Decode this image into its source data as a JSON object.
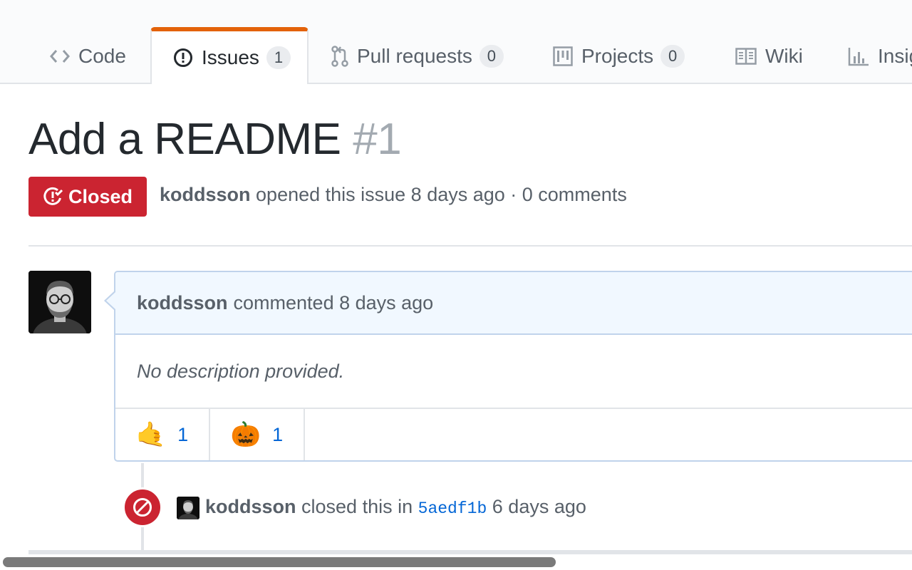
{
  "tabs": [
    {
      "label": "Code",
      "icon": "code-icon"
    },
    {
      "label": "Issues",
      "count": "1",
      "icon": "issue-opened-icon",
      "selected": true
    },
    {
      "label": "Pull requests",
      "count": "0",
      "icon": "git-pull-request-icon"
    },
    {
      "label": "Projects",
      "count": "0",
      "icon": "project-icon"
    },
    {
      "label": "Wiki",
      "icon": "book-icon"
    },
    {
      "label": "Insig",
      "icon": "graph-icon"
    }
  ],
  "issue": {
    "title": "Add a README",
    "number": "#1",
    "state": "Closed",
    "author": "koddsson",
    "meta_text": "opened this issue 8 days ago · 0 comments"
  },
  "comment": {
    "author": "koddsson",
    "header_text": "commented 8 days ago",
    "body": "No description provided.",
    "reactions": [
      {
        "emoji": "🤙",
        "icon": "call-me-hand-emoji",
        "count": "1"
      },
      {
        "emoji": "🎃",
        "icon": "jack-o-lantern-emoji",
        "count": "1"
      }
    ]
  },
  "event": {
    "actor": "koddsson",
    "text_before": "closed this in",
    "commit": "5aedf1b",
    "text_after": "6 days ago",
    "icon": "circle-slash-icon"
  },
  "colors": {
    "closed": "#cb2431",
    "accent_tab": "#e36209",
    "link": "#0366d6",
    "comment_header_bg": "#f1f8ff"
  }
}
